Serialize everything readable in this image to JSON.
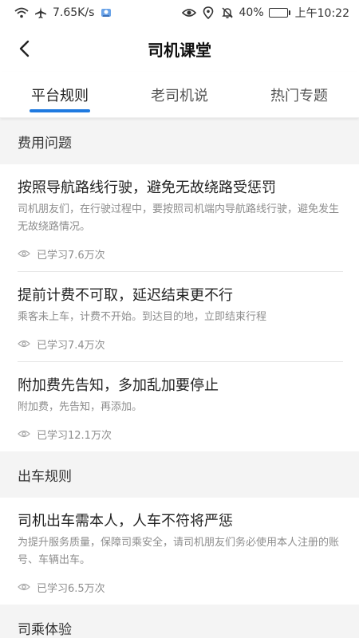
{
  "status_bar": {
    "network_speed": "7.65K/s",
    "battery": "40%",
    "battery_level": 0.4,
    "time": "上午10:22"
  },
  "header": {
    "title": "司机课堂"
  },
  "tabs": [
    {
      "label": "平台规则",
      "active": true
    },
    {
      "label": "老司机说",
      "active": false
    },
    {
      "label": "热门专题",
      "active": false
    }
  ],
  "accent_color": "#1f7ae0",
  "sections": [
    {
      "title": "费用问题",
      "articles": [
        {
          "title": "按照导航路线行驶，避免无故绕路受惩罚",
          "desc": "司机朋友们，在行驶过程中，要按照司机端内导航路线行驶，避免发生无故绕路情况。",
          "views": "已学习7.6万次"
        },
        {
          "title": "提前计费不可取，延迟结束更不行",
          "desc": "乘客未上车，计费不开始。到达目的地，立即结束行程",
          "views": "已学习7.4万次"
        },
        {
          "title": "附加费先告知，多加乱加要停止",
          "desc": "附加费，先告知，再添加。",
          "views": "已学习12.1万次"
        }
      ]
    },
    {
      "title": "出车规则",
      "articles": [
        {
          "title": "司机出车需本人，人车不符将严惩",
          "desc": "为提升服务质量，保障司乘安全，请司机朋友们务必使用本人注册的账号、车辆出车。",
          "views": "已学习6.5万次"
        }
      ]
    },
    {
      "title": "司乘体验",
      "articles": []
    }
  ]
}
